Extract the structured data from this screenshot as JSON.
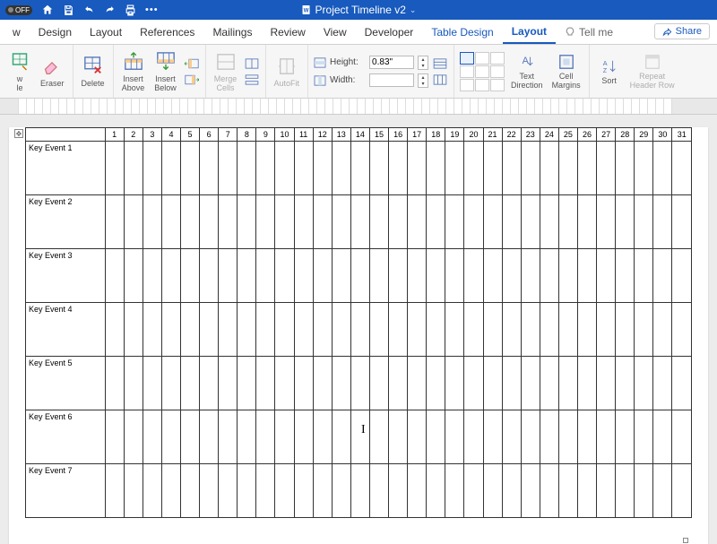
{
  "titlebar": {
    "off_toggle": "OFF",
    "document_name": "Project Timeline v2"
  },
  "tabs": {
    "items": [
      "w",
      "Design",
      "Layout",
      "References",
      "Mailings",
      "Review",
      "View",
      "Developer",
      "Table Design",
      "Layout"
    ],
    "active_index": 9,
    "contextual_start": 8,
    "tellme": "Tell me",
    "share": "Share"
  },
  "ribbon": {
    "draw_table": "w\nle",
    "eraser": "Eraser",
    "delete": "Delete",
    "insert_above": "Insert\nAbove",
    "insert_below": "Insert\nBelow",
    "merge_cells": "Merge\nCells",
    "autofit": "AutoFit",
    "height_label": "Height:",
    "height_value": "0.83\"",
    "width_label": "Width:",
    "width_value": "",
    "text_direction": "Text\nDirection",
    "cell_margins": "Cell\nMargins",
    "sort": "Sort",
    "repeat_header": "Repeat\nHeader Row"
  },
  "table": {
    "days": [
      "1",
      "2",
      "3",
      "4",
      "5",
      "6",
      "7",
      "8",
      "9",
      "10",
      "11",
      "12",
      "13",
      "14",
      "15",
      "16",
      "17",
      "18",
      "19",
      "20",
      "21",
      "22",
      "23",
      "24",
      "25",
      "26",
      "27",
      "28",
      "29",
      "30",
      "31"
    ],
    "rows": [
      "Key Event 1",
      "Key Event 2",
      "Key Event 3",
      "Key Event 4",
      "Key Event 5",
      "Key Event 6",
      "Key Event 7"
    ]
  }
}
